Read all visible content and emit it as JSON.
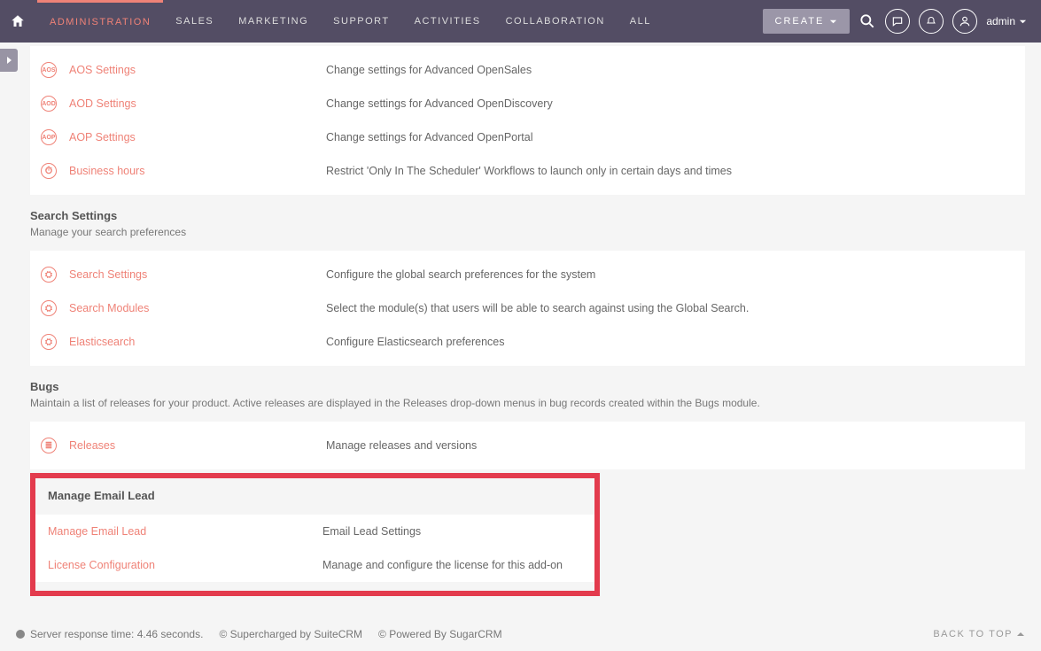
{
  "navbar": {
    "menu": [
      "ADMINISTRATION",
      "SALES",
      "MARKETING",
      "SUPPORT",
      "ACTIVITIES",
      "COLLABORATION",
      "ALL"
    ],
    "create_label": "CREATE",
    "user_label": "admin"
  },
  "sections": {
    "top_rows": [
      {
        "icon": "AOS",
        "link": "AOS Settings",
        "desc": "Change settings for Advanced OpenSales"
      },
      {
        "icon": "AOD",
        "link": "AOD Settings",
        "desc": "Change settings for Advanced OpenDiscovery"
      },
      {
        "icon": "AOP",
        "link": "AOP Settings",
        "desc": "Change settings for Advanced OpenPortal"
      },
      {
        "icon": "⏱",
        "link": "Business hours",
        "desc": "Restrict 'Only In The Scheduler' Workflows to launch only in certain days and times"
      }
    ],
    "search": {
      "title": "Search Settings",
      "desc": "Manage your search preferences",
      "rows": [
        {
          "icon": "⚙",
          "link": "Search Settings",
          "desc": "Configure the global search preferences for the system"
        },
        {
          "icon": "⚙",
          "link": "Search Modules",
          "desc": "Select the module(s) that users will be able to search against using the Global Search."
        },
        {
          "icon": "⚙",
          "link": "Elasticsearch",
          "desc": "Configure Elasticsearch preferences"
        }
      ]
    },
    "bugs": {
      "title": "Bugs",
      "desc": "Maintain a list of releases for your product. Active releases are displayed in the Releases drop-down menus in bug records created within the Bugs module.",
      "rows": [
        {
          "icon": "≋",
          "link": "Releases",
          "desc": "Manage releases and versions"
        }
      ]
    },
    "emaillead": {
      "title": "Manage Email Lead",
      "rows": [
        {
          "link": "Manage Email Lead",
          "desc": "Email Lead Settings"
        },
        {
          "link": "License Configuration",
          "desc": "Manage and configure the license for this add-on"
        }
      ]
    }
  },
  "footer": {
    "server_time": "Server response time: 4.46 seconds.",
    "supercharged": "© Supercharged by SuiteCRM",
    "powered": "© Powered By SugarCRM",
    "backtop": "BACK TO TOP"
  }
}
